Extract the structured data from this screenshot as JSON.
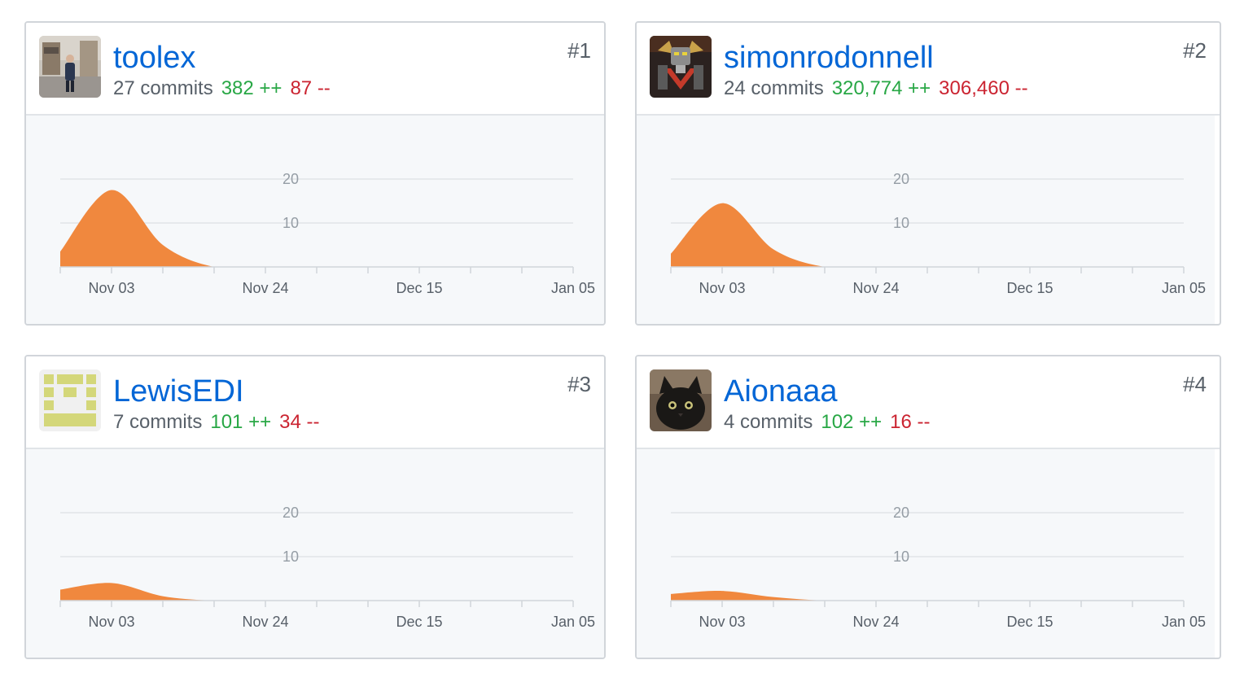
{
  "accent": "#0366d6",
  "area_color": "#f0883e",
  "add_color": "#28a745",
  "del_color": "#cb2431",
  "contributors": [
    {
      "username": "toolex",
      "commits": "27 commits",
      "additions": "382 ++",
      "deletions": "87 --",
      "rank": "#1",
      "avatar_icon": "person-photo-avatar"
    },
    {
      "username": "simonrodonnell",
      "commits": "24 commits",
      "additions": "320,774 ++",
      "deletions": "306,460 --",
      "rank": "#2",
      "avatar_icon": "robot-mecha-avatar"
    },
    {
      "username": "LewisEDI",
      "commits": "7 commits",
      "additions": "101 ++",
      "deletions": "34 --",
      "rank": "#3",
      "avatar_icon": "identicon-avatar"
    },
    {
      "username": "Aionaaa",
      "commits": "4 commits",
      "additions": "102 ++",
      "deletions": "16 --",
      "rank": "#4",
      "avatar_icon": "cat-photo-avatar"
    }
  ],
  "chart_data": [
    {
      "type": "area",
      "series": [
        {
          "x": [
            "Oct 27",
            "Nov 03",
            "Nov 10",
            "Nov 17",
            "Nov 24",
            "Dec 01",
            "Dec 08",
            "Dec 15",
            "Dec 22",
            "Dec 29",
            "Jan 05"
          ],
          "values": [
            3.5,
            17.5,
            5,
            0,
            0,
            0,
            0,
            0,
            0,
            0,
            0
          ]
        }
      ],
      "x_tick_labels": [
        "Nov 03",
        "Nov 24",
        "Dec 15",
        "Jan 05"
      ],
      "y_tick_labels": [
        "10",
        "20"
      ],
      "ylim": [
        0,
        20
      ],
      "grid": true
    },
    {
      "type": "area",
      "series": [
        {
          "x": [
            "Oct 27",
            "Nov 03",
            "Nov 10",
            "Nov 17",
            "Nov 24",
            "Dec 01",
            "Dec 08",
            "Dec 15",
            "Dec 22",
            "Dec 29",
            "Jan 05"
          ],
          "values": [
            3,
            14.5,
            4,
            0,
            0,
            0,
            0,
            0,
            0,
            0,
            0
          ]
        }
      ],
      "x_tick_labels": [
        "Nov 03",
        "Nov 24",
        "Dec 15",
        "Jan 05"
      ],
      "y_tick_labels": [
        "10",
        "20"
      ],
      "ylim": [
        0,
        20
      ],
      "grid": true
    },
    {
      "type": "area",
      "series": [
        {
          "x": [
            "Oct 27",
            "Nov 03",
            "Nov 10",
            "Nov 17",
            "Nov 24",
            "Dec 01",
            "Dec 08",
            "Dec 15",
            "Dec 22",
            "Dec 29",
            "Jan 05"
          ],
          "values": [
            2.5,
            4,
            1,
            0,
            0,
            0,
            0,
            0,
            0,
            0,
            0
          ]
        }
      ],
      "x_tick_labels": [
        "Nov 03",
        "Nov 24",
        "Dec 15",
        "Jan 05"
      ],
      "y_tick_labels": [
        "10",
        "20"
      ],
      "ylim": [
        0,
        20
      ],
      "grid": true
    },
    {
      "type": "area",
      "series": [
        {
          "x": [
            "Oct 27",
            "Nov 03",
            "Nov 10",
            "Nov 17",
            "Nov 24",
            "Dec 01",
            "Dec 08",
            "Dec 15",
            "Dec 22",
            "Dec 29",
            "Jan 05"
          ],
          "values": [
            1.5,
            2.2,
            0.8,
            0,
            0,
            0,
            0,
            0,
            0,
            0,
            0
          ]
        }
      ],
      "x_tick_labels": [
        "Nov 03",
        "Nov 24",
        "Dec 15",
        "Jan 05"
      ],
      "y_tick_labels": [
        "10",
        "20"
      ],
      "ylim": [
        0,
        20
      ],
      "grid": true
    }
  ]
}
